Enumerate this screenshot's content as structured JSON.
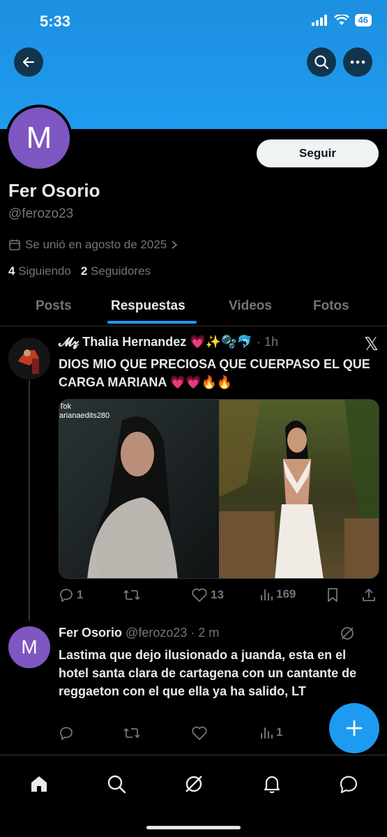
{
  "status_bar": {
    "time": "5:33",
    "battery": "46"
  },
  "profile": {
    "avatar_letter": "M",
    "follow_label": "Seguir",
    "name": "Fer Osorio",
    "handle": "@ferozo23",
    "joined": "Se unió en agosto de 2025",
    "following_count": "4",
    "following_label": "Siguiendo",
    "followers_count": "2",
    "followers_label": "Seguidores"
  },
  "tabs": [
    {
      "label": "Posts",
      "active": false
    },
    {
      "label": "Respuestas",
      "active": true
    },
    {
      "label": "Videos",
      "active": false
    },
    {
      "label": "Fotos",
      "active": false
    }
  ],
  "post": {
    "author": "𝓜𝔃 Thalia Hernandez 💗✨🫧🐬",
    "time": "· 1h",
    "text": "DIOS MIO QUE PRECIOSA QUE CUERPASO EL QUE CARGA MARIANA 💗💗🔥🔥",
    "media_watermark_1": "Tok",
    "media_watermark_2": "arianaedits280",
    "replies": "1",
    "reposts": "",
    "likes": "13",
    "views": "169"
  },
  "reply": {
    "avatar_letter": "M",
    "author": "Fer Osorio",
    "handle_time": "@ferozo23 · 2 m",
    "text": "Lastima que dejo ilusionado a juanda, esta en el hotel santa clara de cartagena con un cantante de reggaeton con el que ella ya ha salido, LT",
    "views": "1"
  },
  "colors": {
    "accent": "#1d9bf0",
    "avatar": "#7e57c2",
    "banner": "#1f9bef"
  }
}
